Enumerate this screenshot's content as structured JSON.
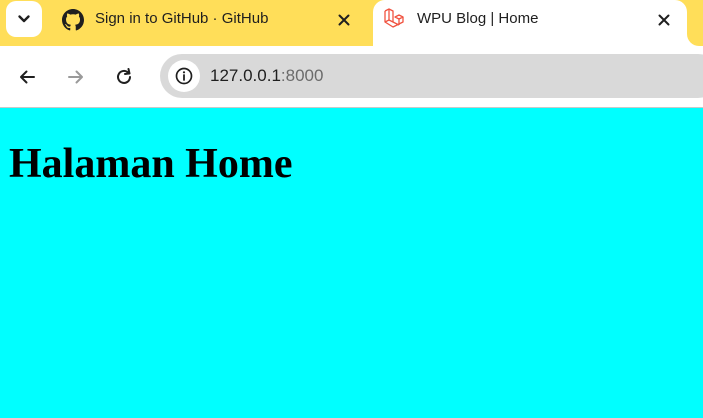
{
  "browser": {
    "tabs": [
      {
        "title": "Sign in to GitHub · GitHub",
        "icon": "github-icon",
        "active": false
      },
      {
        "title": "WPU Blog | Home",
        "icon": "laravel-icon",
        "active": true
      }
    ],
    "address": {
      "host": "127.0.0.1",
      "port": ":8000"
    },
    "colors": {
      "tabstrip": "#ffde59",
      "omnibox": "#d9d9d9",
      "page_background": "#00ffff"
    }
  },
  "page": {
    "heading": "Halaman Home"
  }
}
